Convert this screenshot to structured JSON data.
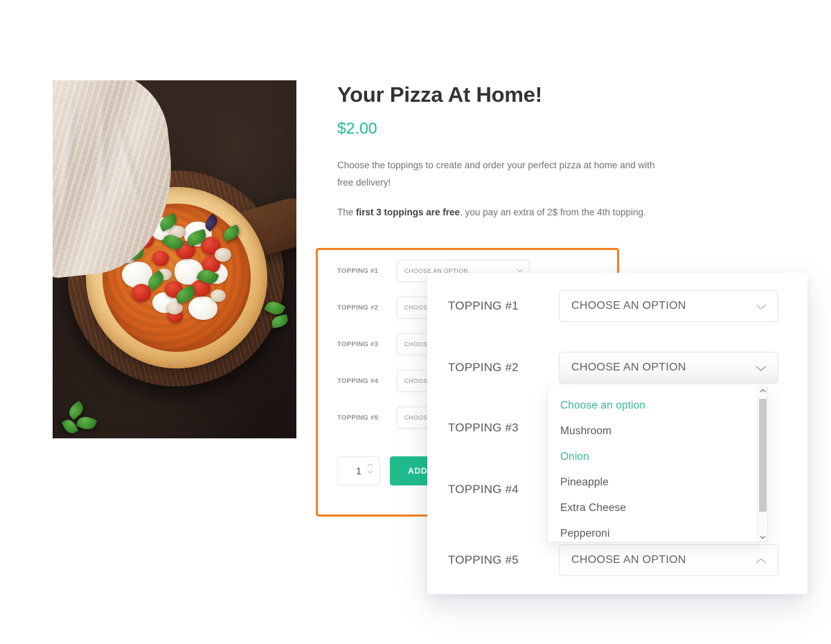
{
  "product": {
    "title": "Your Pizza At Home!",
    "price": "$2.00",
    "description_1": "Choose the toppings to create and order your perfect pizza at home and with free delivery!",
    "description_2_prefix": "The ",
    "description_2_bold": "first 3 toppings are free",
    "description_2_suffix": ", you pay an extra of 2$ from the 4th topping.",
    "image_alt": "margherita-pizza-on-wooden-board"
  },
  "form": {
    "rows": [
      {
        "label": "Topping #1",
        "value": "Choose an option"
      },
      {
        "label": "Topping #2",
        "value": "Choose an option"
      },
      {
        "label": "Topping #3",
        "value": "Choose an option"
      },
      {
        "label": "Topping #4",
        "value": "Choose an option"
      },
      {
        "label": "Topping #5",
        "value": "Choose an option"
      }
    ],
    "quantity": "1",
    "add_to_cart_label": "ADD TO CART"
  },
  "popup": {
    "rows": [
      {
        "label": "Topping #1",
        "value": "Choose an option",
        "state": "closed"
      },
      {
        "label": "Topping #2",
        "value": "Choose an option",
        "state": "open"
      },
      {
        "label": "Topping #3",
        "value": "",
        "state": "hidden"
      },
      {
        "label": "Topping #4",
        "value": "",
        "state": "hidden"
      },
      {
        "label": "Topping #5",
        "value": "Choose an option",
        "state": "expanded"
      }
    ],
    "dropdown": {
      "options": [
        {
          "label": "Choose an option",
          "highlighted": true
        },
        {
          "label": "Mushroom",
          "highlighted": false
        },
        {
          "label": "Onion",
          "highlighted": true
        },
        {
          "label": "Pineapple",
          "highlighted": false
        },
        {
          "label": "Extra Cheese",
          "highlighted": false
        },
        {
          "label": "Pepperoni",
          "highlighted": false
        }
      ]
    }
  },
  "colors": {
    "accent_teal": "#1fc08a",
    "highlight_orange": "#f58220",
    "option_teal": "#3ab795",
    "text_dark": "#333333",
    "text_muted": "#6f7276"
  }
}
